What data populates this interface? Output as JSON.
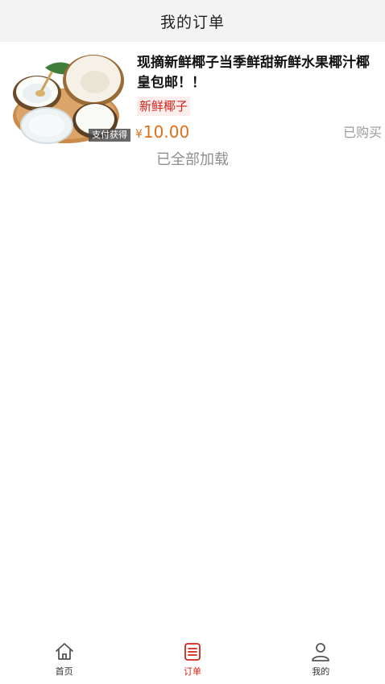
{
  "header": {
    "title": "我的订单"
  },
  "orders": [
    {
      "title": "现摘新鲜椰子当季鲜甜新鲜水果椰汁椰皇包邮！！",
      "tag": "新鲜椰子",
      "badge": "支付获得",
      "currency": "¥",
      "price": "10.00",
      "status": "已购买"
    }
  ],
  "list_footer": "已全部加载",
  "nav": {
    "items": [
      {
        "label": "首页",
        "icon": "home-icon"
      },
      {
        "label": "订单",
        "icon": "order-icon",
        "active": true
      },
      {
        "label": "我的",
        "icon": "user-icon"
      }
    ]
  },
  "colors": {
    "accent": "#d0241c",
    "price": "#e07018",
    "muted": "#9a9a9a",
    "header_bg": "#f3f3f3"
  }
}
